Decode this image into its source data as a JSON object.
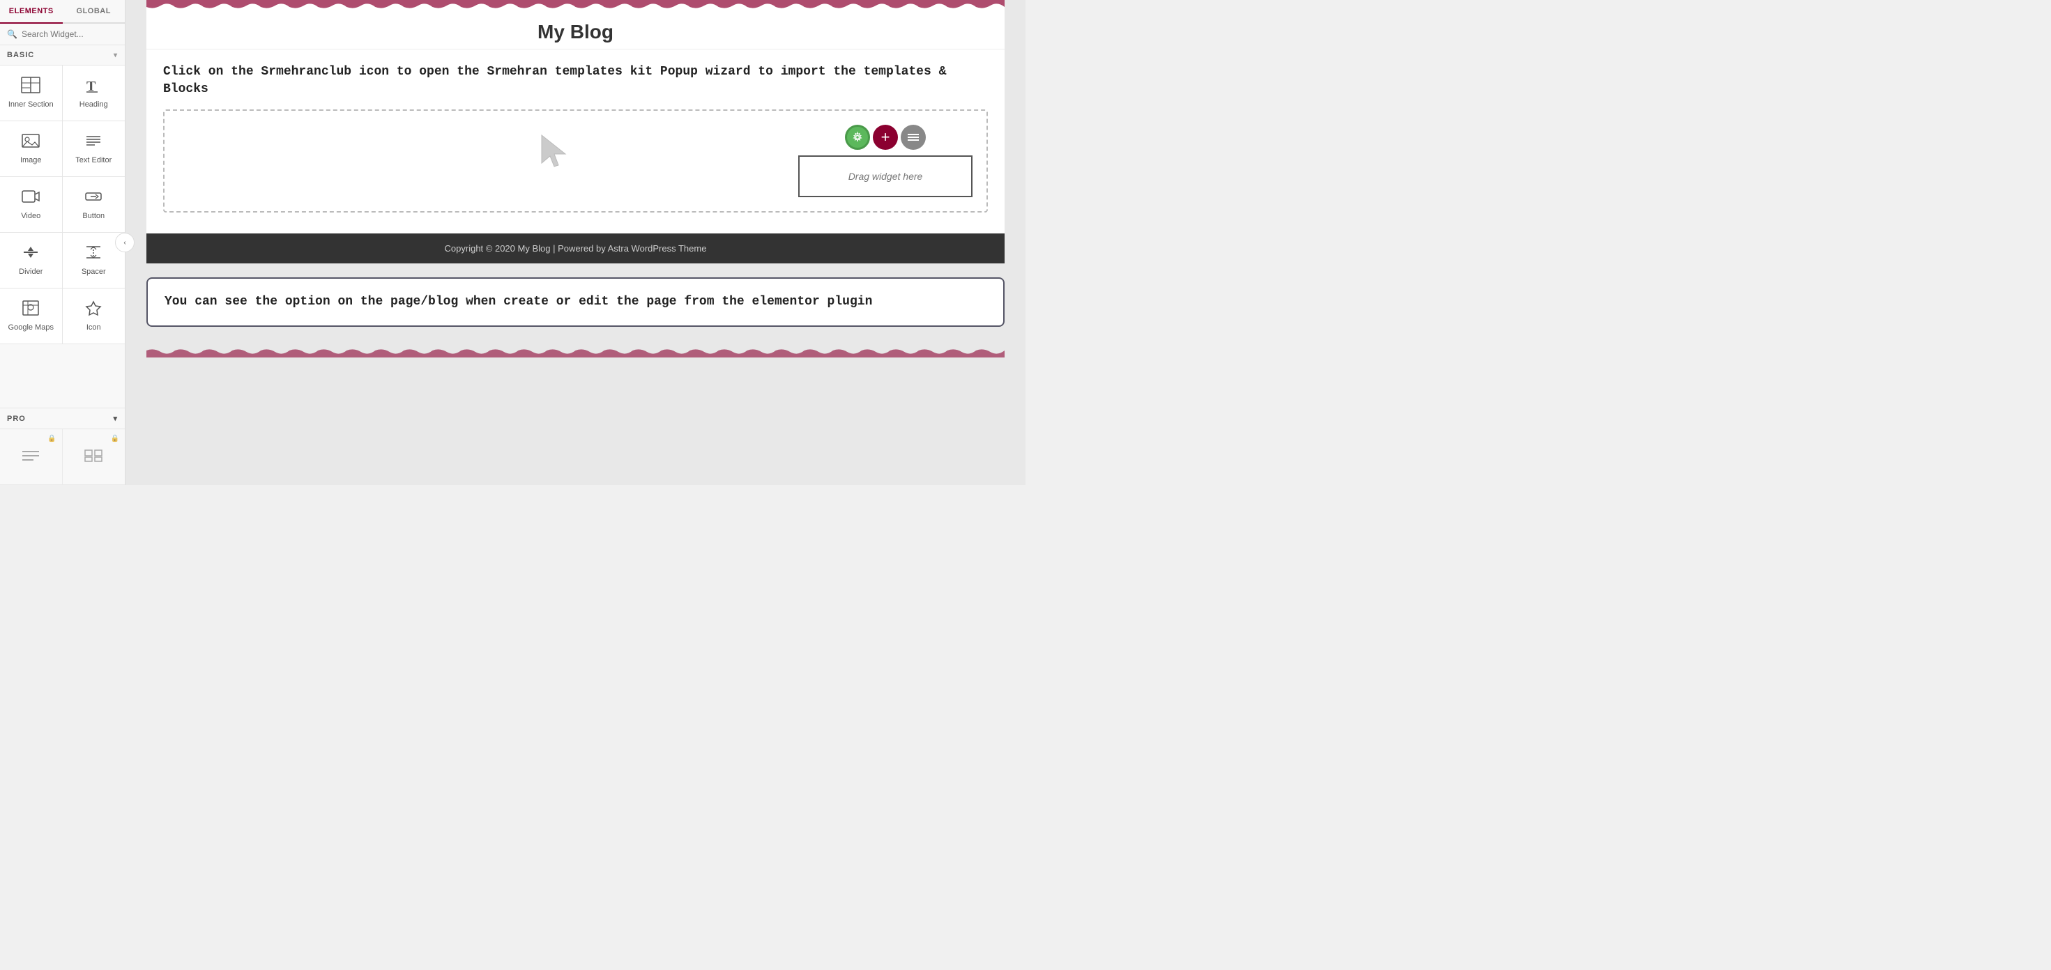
{
  "sidebar": {
    "tabs": [
      {
        "label": "ELEMENTS",
        "active": true
      },
      {
        "label": "GLOBAL",
        "active": false
      }
    ],
    "search": {
      "placeholder": "Search Widget..."
    },
    "basic_section": {
      "label": "BASIC"
    },
    "widgets": [
      {
        "id": "inner-section",
        "label": "Inner Section",
        "icon": "grid"
      },
      {
        "id": "heading",
        "label": "Heading",
        "icon": "text-header"
      },
      {
        "id": "image",
        "label": "Image",
        "icon": "image"
      },
      {
        "id": "text-editor",
        "label": "Text Editor",
        "icon": "text-align"
      },
      {
        "id": "video",
        "label": "Video",
        "icon": "video"
      },
      {
        "id": "button",
        "label": "Button",
        "icon": "cursor"
      },
      {
        "id": "divider",
        "label": "Divider",
        "icon": "divider"
      },
      {
        "id": "spacer",
        "label": "Spacer",
        "icon": "spacer"
      },
      {
        "id": "google-maps",
        "label": "Google Maps",
        "icon": "map"
      },
      {
        "id": "icon",
        "label": "Icon",
        "icon": "star"
      }
    ],
    "pro_section": {
      "label": "PRO"
    },
    "pro_widgets": [
      {
        "id": "pro-widget-1",
        "label": "",
        "locked": true
      },
      {
        "id": "pro-widget-2",
        "label": "",
        "locked": true
      }
    ]
  },
  "main": {
    "blog_title": "My Blog",
    "instruction_text": "Click on the Srmehranclub icon to open the Srmehran templates kit Popup wizard to import the templates & Blocks",
    "drag_text": "Drag widget here",
    "footer_text": "Copyright © 2020 My Blog | Powered by Astra WordPress Theme",
    "info_box_text": "You can see the option on the page/blog when create or edit the page from the elementor plugin",
    "collapse_btn": "‹"
  }
}
